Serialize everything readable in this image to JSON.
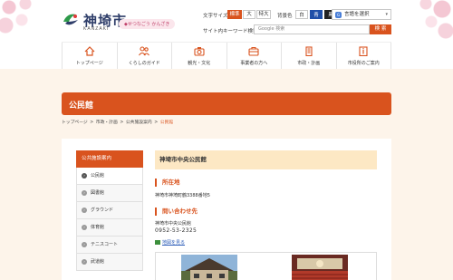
{
  "header": {
    "city_name": "神埼市",
    "city_roman": "KANZAKI",
    "tagline": "◆せつなごう かんざき",
    "font_size_label": "文字サイズ",
    "font_sizes": [
      "標準",
      "大",
      "特大"
    ],
    "bg_color_label": "背景色",
    "bg_colors": [
      {
        "label": "白",
        "bg": "#ffffff",
        "fg": "#333333"
      },
      {
        "label": "青",
        "bg": "#1f4fa8",
        "fg": "#ffffff"
      },
      {
        "label": "黒",
        "bg": "#222222",
        "fg": "#ffffff"
      }
    ],
    "language_label": "言語を選択",
    "site_search_label": "サイト内キーワード検索",
    "search_placeholder": "Google 検索",
    "search_button": "検 索"
  },
  "nav": [
    {
      "label": "トップページ",
      "icon": "home-icon"
    },
    {
      "label": "くらしのガイド",
      "icon": "people-icon"
    },
    {
      "label": "観光・文化",
      "icon": "camera-icon"
    },
    {
      "label": "事業者の方へ",
      "icon": "briefcase-icon"
    },
    {
      "label": "市政・計画",
      "icon": "building-icon"
    },
    {
      "label": "市役所のご案内",
      "icon": "info-icon"
    }
  ],
  "page_title": "公民館",
  "breadcrumb": [
    {
      "label": "トップページ",
      "current": false
    },
    {
      "label": "市政・計画",
      "current": false
    },
    {
      "label": "公共施設案内",
      "current": false
    },
    {
      "label": "公民館",
      "current": true
    }
  ],
  "sidebar": {
    "heading": "公共施設案内",
    "items": [
      {
        "label": "公民館",
        "active": true
      },
      {
        "label": "図書館",
        "active": false
      },
      {
        "label": "グラウンド",
        "active": false
      },
      {
        "label": "体育館",
        "active": false
      },
      {
        "label": "テニスコート",
        "active": false
      },
      {
        "label": "武道館",
        "active": false
      }
    ]
  },
  "content": {
    "facility_title": "神埼市中央公民館",
    "address_heading": "所在地",
    "address": "神埼市神埼町鶴3388番地5",
    "contact_heading": "問い合わせ先",
    "contact_name": "神埼市中央公民館",
    "contact_phone": "0952-53-2325",
    "map_link": "地図を見る"
  },
  "colors": {
    "accent": "#d9531e",
    "page_bg": "#fdf4ea",
    "title_bg": "#fde8c4"
  }
}
